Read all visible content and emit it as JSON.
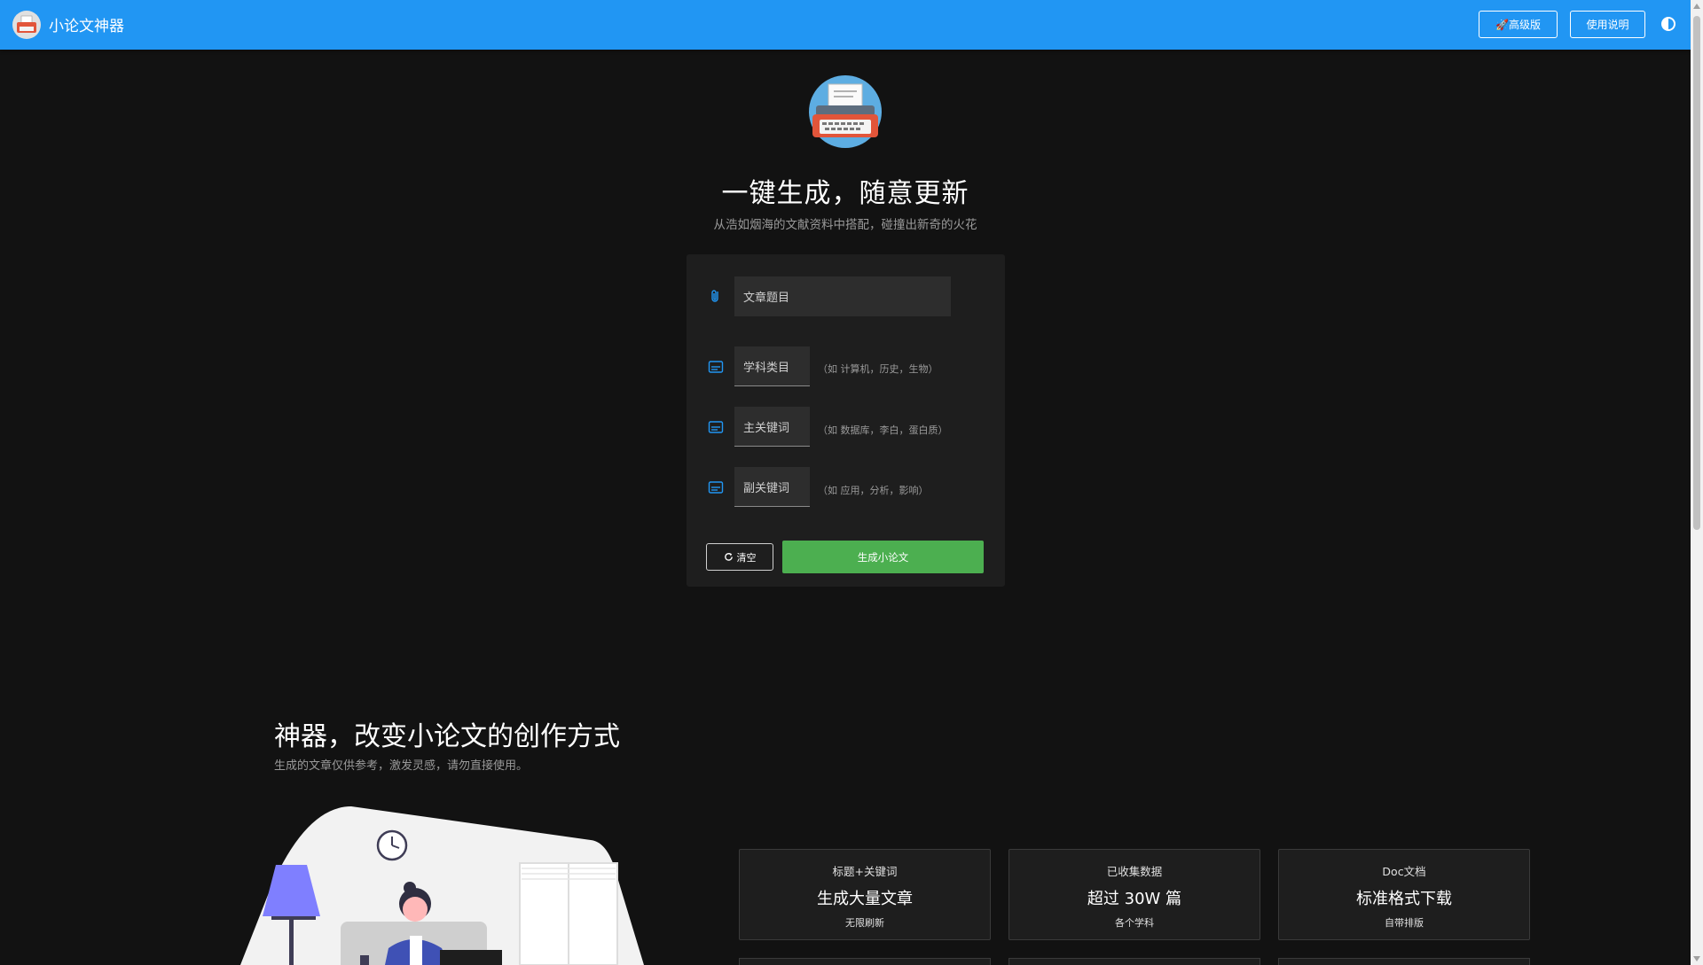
{
  "header": {
    "brand": "小论文神器",
    "pro_label": "🚀高级版",
    "help_label": "使用说明"
  },
  "hero": {
    "title": "一键生成，随意更新",
    "subtitle": "从浩如烟海的文献资料中搭配，碰撞出新奇的火花"
  },
  "form": {
    "title_placeholder": "文章题目",
    "fields": [
      {
        "label": "学科类目",
        "hint": "（如 计算机，历史，生物）"
      },
      {
        "label": "主关键词",
        "hint": "（如 数据库，李白，蛋白质）"
      },
      {
        "label": "副关键词",
        "hint": "（如 应用，分析，影响）"
      }
    ],
    "clear_label": "清空",
    "generate_label": "生成小论文"
  },
  "features": {
    "title": "神器，改变小论文的创作方式",
    "subtitle": "生成的文章仅供参考，激发灵感，请勿直接使用。",
    "cards": [
      {
        "top": "标题+关键词",
        "mid": "生成大量文章",
        "bot": "无限刷新"
      },
      {
        "top": "已收集数据",
        "mid": "超过 30W 篇",
        "bot": "各个学科"
      },
      {
        "top": "Doc文档",
        "mid": "标准格式下载",
        "bot": "自带排版"
      }
    ]
  },
  "colors": {
    "accent": "#2196f3",
    "primary_action": "#4caf50",
    "background": "#121212"
  }
}
